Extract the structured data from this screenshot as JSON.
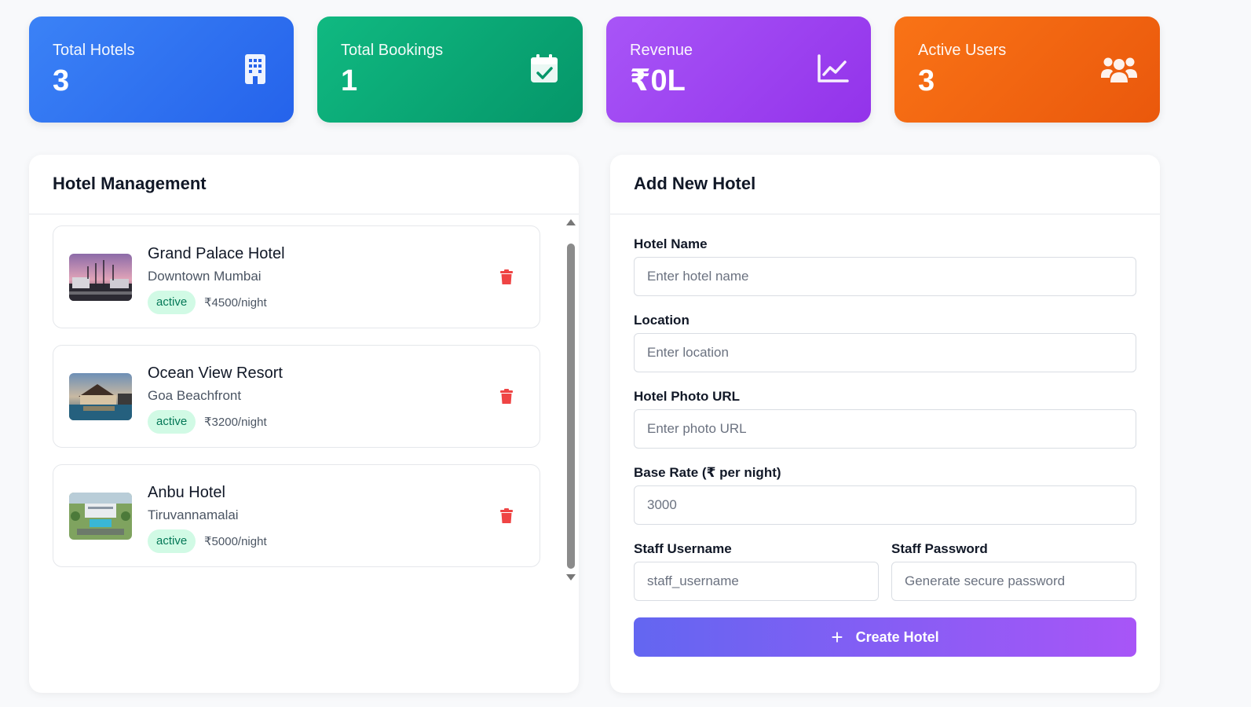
{
  "stats": [
    {
      "label": "Total Hotels",
      "value": "3",
      "icon": "building-icon"
    },
    {
      "label": "Total Bookings",
      "value": "1",
      "icon": "calendar-check-icon"
    },
    {
      "label": "Revenue",
      "value": "₹0L",
      "icon": "chart-line-icon"
    },
    {
      "label": "Active Users",
      "value": "3",
      "icon": "users-icon"
    }
  ],
  "hotel_management": {
    "title": "Hotel Management",
    "hotels": [
      {
        "name": "Grand Palace Hotel",
        "location": "Downtown Mumbai",
        "status": "active",
        "rate": "₹4500/night"
      },
      {
        "name": "Ocean View Resort",
        "location": "Goa Beachfront",
        "status": "active",
        "rate": "₹3200/night"
      },
      {
        "name": "Anbu Hotel",
        "location": "Tiruvannamalai",
        "status": "active",
        "rate": "₹5000/night"
      }
    ]
  },
  "add_hotel": {
    "title": "Add New Hotel",
    "hotel_name": {
      "label": "Hotel Name",
      "placeholder": "Enter hotel name"
    },
    "location": {
      "label": "Location",
      "placeholder": "Enter location"
    },
    "photo_url": {
      "label": "Hotel Photo URL",
      "placeholder": "Enter photo URL"
    },
    "base_rate": {
      "label": "Base Rate (₹ per night)",
      "placeholder": "3000"
    },
    "staff_username": {
      "label": "Staff Username",
      "placeholder": "staff_username"
    },
    "staff_password": {
      "label": "Staff Password",
      "placeholder": "Generate secure password"
    },
    "submit": {
      "icon": "+",
      "label": "Create Hotel"
    }
  },
  "colors": {
    "hotels_card": "#3b82f6",
    "bookings_card": "#10b981",
    "revenue_card": "#a855f7",
    "users_card": "#f97316",
    "delete": "#ef4444",
    "badge_bg": "#d1fae5",
    "badge_text": "#047857"
  }
}
